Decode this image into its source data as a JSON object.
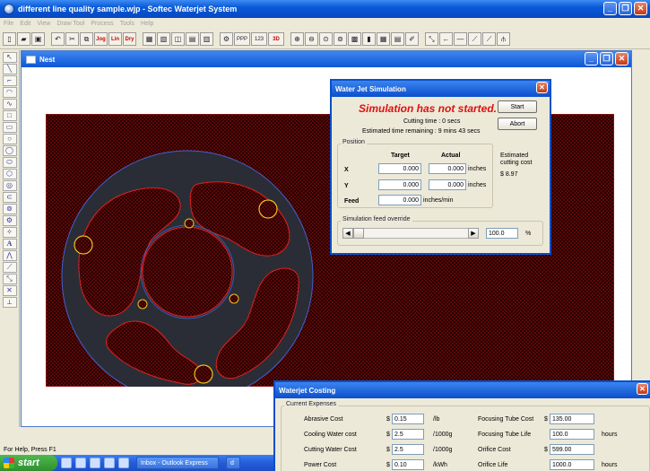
{
  "app": {
    "title": "different line quality sample.wjp - Softec Waterjet System",
    "menu": [
      "File",
      "Edit",
      "View",
      "Draw Tool",
      "Process",
      "Tools",
      "Help"
    ]
  },
  "toolbar": {
    "buttons": [
      "new-icon",
      "open-icon",
      "save-icon",
      "undo-icon",
      "cut-icon",
      "copy-icon",
      "lead-in-icon",
      "lead-out-icon",
      "drawing-icon",
      "nest-icon",
      "parts-icon",
      "layers-icon",
      "quality-icon",
      "settings-icon",
      "feed-rate-icon",
      "zoom-in-icon",
      "zoom-out-icon",
      "zoom-window-icon",
      "zoom-extents-icon",
      "grid-icon",
      "simulate-icon",
      "table-icon",
      "cost-icon",
      "path-icon",
      "line-tools-icon"
    ],
    "ppp_label": "PPP",
    "num_label": "123",
    "inv_label": "3D",
    "jog_label": "Jog",
    "lin_label": "Lin",
    "dry_label": "Dry"
  },
  "toolbox": {
    "items": [
      "arrow-icon",
      "line-icon",
      "polyline-icon",
      "arc-icon",
      "spline-icon",
      "rectangle-icon",
      "square-icon",
      "circle-icon",
      "circle-3pt-icon",
      "ellipse-icon",
      "polygon-icon",
      "ring-icon",
      "slot-icon",
      "donut-icon",
      "gear-icon",
      "star-icon",
      "text-icon",
      "hatch-icon",
      "trim-icon",
      "mirror-icon",
      "explode-icon",
      "break-icon"
    ],
    "text_glyph": "A"
  },
  "nest": {
    "title": "Nest"
  },
  "simulation": {
    "title": "Water Jet Simulation",
    "status": "Simulation has not started.",
    "cutting_time": "Cutting time : 0 secs",
    "remaining": "Estimated time remaining : 9 mins 43 secs",
    "start_label": "Start",
    "abort_label": "Abort",
    "position_label": "Position",
    "target_label": "Target",
    "actual_label": "Actual",
    "x_label": "X",
    "y_label": "Y",
    "feed_label": "Feed",
    "x_target": "0.000",
    "x_actual": "0.000",
    "y_target": "0.000",
    "y_actual": "0.000",
    "feed_value": "0.000",
    "unit_inches": "inches",
    "unit_feed": "inches/min",
    "est_cost_label": "Estimated cutting cost",
    "est_cost_value": "$ 8.97",
    "override_label": "Simulation feed override",
    "override_value": "100.0",
    "override_fraction": 0.0,
    "percent": "%"
  },
  "costing": {
    "title": "Waterjet Costing",
    "group_label": "Current Expenses",
    "rows": [
      {
        "label": "Abrasive Cost",
        "currency": "$",
        "value": "0.15",
        "unit": "/lb",
        "r_label": "Focusing Tube Cost",
        "r_currency": "$",
        "r_value": "135.00",
        "r_unit": ""
      },
      {
        "label": "Cooling Water cost",
        "currency": "$",
        "value": "2.5",
        "unit": "/1000g",
        "r_label": "Focusing Tube Life",
        "r_currency": "",
        "r_value": "100.0",
        "r_unit": "hours"
      },
      {
        "label": "Cutting Water Cost",
        "currency": "$",
        "value": "2.5",
        "unit": "/1000g",
        "r_label": "Orifice Cost",
        "r_currency": "$",
        "r_value": "599.00",
        "r_unit": ""
      },
      {
        "label": "Power Cost",
        "currency": "$",
        "value": "0.10",
        "unit": "/kWh",
        "r_label": "Orifice Life",
        "r_currency": "",
        "r_value": "1000.0",
        "r_unit": "hours"
      }
    ]
  },
  "statusbar": {
    "text": "For Help, Press F1"
  },
  "taskbar": {
    "start_label": "start",
    "items": [
      "Inbox - Outlook Express",
      "d"
    ]
  }
}
